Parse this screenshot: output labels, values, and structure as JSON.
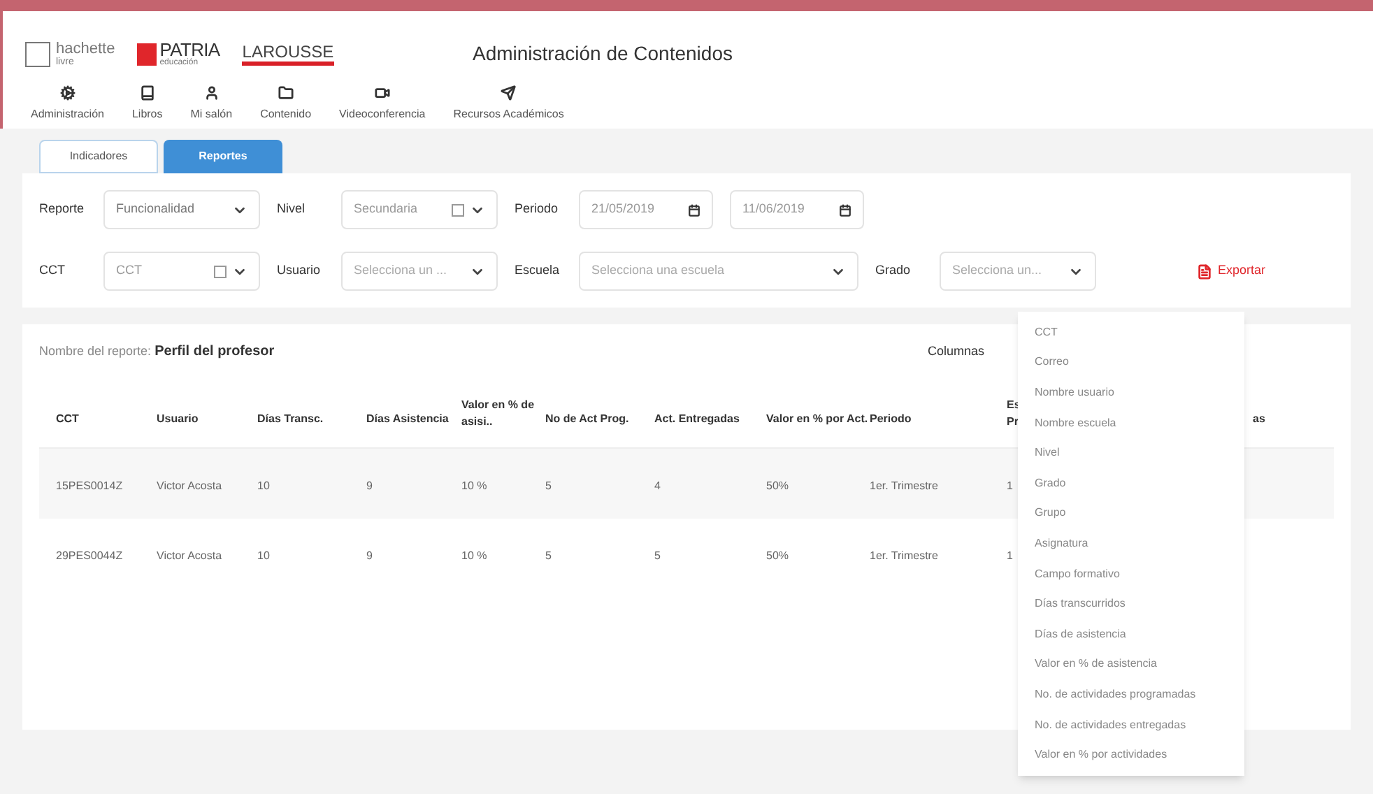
{
  "logos": [
    {
      "kind": "hachette",
      "text": "hachette",
      "sub": "livre"
    },
    {
      "kind": "patria",
      "text": "PATRIA",
      "sub": "educación"
    },
    {
      "kind": "larousse",
      "text": "LAROUSSE"
    }
  ],
  "title": "Administración de Contenidos",
  "nav": [
    {
      "label": "Administración"
    },
    {
      "label": "Libros"
    },
    {
      "label": "Mi salón"
    },
    {
      "label": "Contenido"
    },
    {
      "label": "Videoconferencia"
    },
    {
      "label": "Recursos Académicos"
    }
  ],
  "tabs": [
    {
      "label": "Indicadores",
      "selected": false
    },
    {
      "label": "Reportes",
      "selected": true
    }
  ],
  "filters": [
    [
      {
        "label": "Reporte",
        "kind": "select",
        "value": "Funcionalidad"
      },
      {
        "label": "Nivel",
        "kind": "check-select",
        "value": "Secundaria",
        "checked": false
      },
      {
        "label": "Periodo",
        "kind": "date",
        "value": "21/05/2019"
      },
      {
        "kind": "date",
        "value": "11/06/2019"
      }
    ],
    [
      {
        "label": "CCT",
        "kind": "check-select",
        "value": "CCT",
        "checked": false
      },
      {
        "label": "Usuario",
        "kind": "select",
        "placeholder": "Selecciona un ..."
      },
      {
        "label": "Escuela",
        "kind": "wide-select",
        "placeholder": "Selecciona una escuela"
      },
      {
        "label": "Grado",
        "kind": "select",
        "placeholder": "Selecciona un..."
      }
    ]
  ],
  "export": "Exportar",
  "report_name": {
    "label": "Nombre del reporte:",
    "value": "Perfil del profesor"
  },
  "columns_label": "Columnas",
  "table": {
    "columns": [
      "CCT",
      "Usuario",
      "Días Transc.",
      "Días Asistencia",
      "Valor en % de asisi..",
      "No de Act Prog.",
      "Act. Entregadas",
      "Valor en % por Act.",
      "Periodo",
      "Es Pr",
      "as"
    ],
    "rows": [
      [
        "15PES0014Z",
        "Victor Acosta",
        "10",
        "9",
        "10 %",
        "5",
        "4",
        "50%",
        "1er. Trimestre",
        "1"
      ],
      [
        "29PES0044Z",
        "Victor Acosta",
        "10",
        "9",
        "10 %",
        "5",
        "5",
        "50%",
        "1er. Trimestre",
        "1"
      ]
    ]
  },
  "dropdown": [
    "CCT",
    "Correo",
    "Nombre usuario",
    "Nombre escuela",
    "Nivel",
    "Grado",
    "Grupo",
    "Asignatura",
    "Campo formativo",
    "Días transcurridos",
    "Días de asistencia",
    "Valor en % de asistencia",
    "No. de actividades programadas",
    "No. de actividades entregadas",
    "Valor en % por actividades"
  ]
}
